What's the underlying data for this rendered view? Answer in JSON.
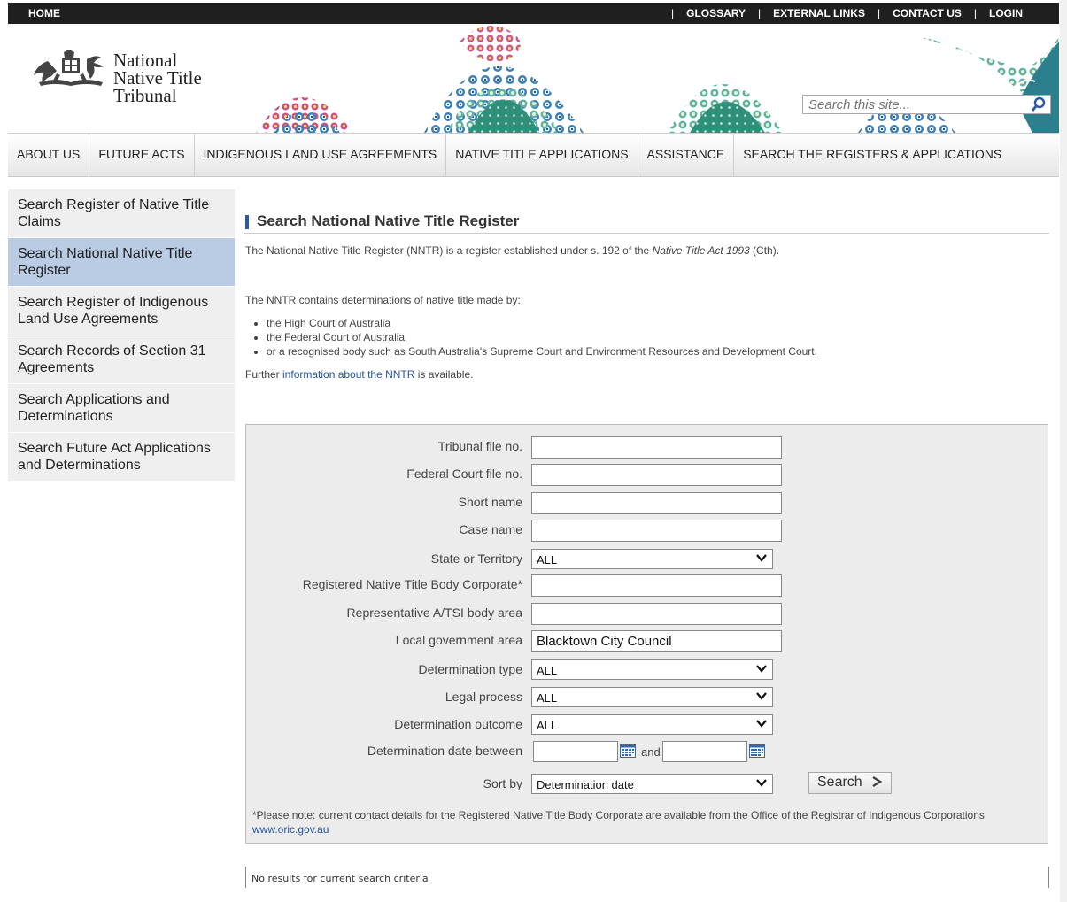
{
  "topbar": {
    "home": "HOME",
    "links": [
      "GLOSSARY",
      "EXTERNAL LINKS",
      "CONTACT US",
      "LOGIN"
    ]
  },
  "brand": {
    "line1": "National",
    "line2": "Native Title",
    "line3": "Tribunal"
  },
  "site_search": {
    "placeholder": "Search this site..."
  },
  "mainnav": [
    "ABOUT US",
    "FUTURE ACTS",
    "INDIGENOUS LAND USE AGREEMENTS",
    "NATIVE TITLE APPLICATIONS",
    "ASSISTANCE",
    "SEARCH THE REGISTERS & APPLICATIONS"
  ],
  "sidebar": [
    "Search Register of Native Title Claims",
    "Search National Native Title Register",
    "Search Register of Indigenous Land Use Agreements",
    "Search Records of Section 31 Agreements",
    "Search Applications and Determinations",
    "Search Future Act Applications and Determinations"
  ],
  "sidebar_active_index": 1,
  "page": {
    "title": "Search National Native Title Register",
    "intro_before": "The National Native Title Register (NNTR) is a register established under s. 192 of the ",
    "intro_act": "Native Title Act 1993",
    "intro_after": " (Cth).",
    "determinations_intro": "The NNTR contains determinations of native title made by:",
    "courts": [
      "the High Court of Australia",
      "the Federal Court of Australia",
      "or a recognised body such as South Australia's Supreme Court and Environment Resources and Development Court."
    ],
    "further_before": "Further ",
    "further_link": "information about the NNTR",
    "further_after": " is available."
  },
  "form": {
    "tribunal_file": {
      "label": "Tribunal file no.",
      "value": ""
    },
    "federal_file": {
      "label": "Federal Court file no.",
      "value": ""
    },
    "short_name": {
      "label": "Short name",
      "value": ""
    },
    "case_name": {
      "label": "Case name",
      "value": ""
    },
    "state": {
      "label": "State or Territory",
      "value": "ALL"
    },
    "rntbc": {
      "label": "Registered Native Title Body Corporate*",
      "value": ""
    },
    "rep_body": {
      "label": "Representative A/TSI body area",
      "value": ""
    },
    "lga": {
      "label": "Local government area",
      "value": "Blacktown City Council"
    },
    "det_type": {
      "label": "Determination type",
      "value": "ALL"
    },
    "legal_process": {
      "label": "Legal process",
      "value": "ALL"
    },
    "det_outcome": {
      "label": "Determination outcome",
      "value": "ALL"
    },
    "det_date": {
      "label": "Determination date between",
      "and": "and",
      "from": "",
      "to": ""
    },
    "sort_by": {
      "label": "Sort by",
      "value": "Determination date"
    },
    "search_button": "Search",
    "note": "*Please note: current contact details for the Registered Native Title Body Corporate are available from the Office of the Registrar of Indigenous Corporations ",
    "note_link": "www.oric.gov.au"
  },
  "results": {
    "message": "No results for current search criteria"
  },
  "colors": {
    "accent": "#2b59a8",
    "active_nav": "#b9cce4",
    "link": "#2455a0",
    "topbar": "#1f1f1f"
  }
}
